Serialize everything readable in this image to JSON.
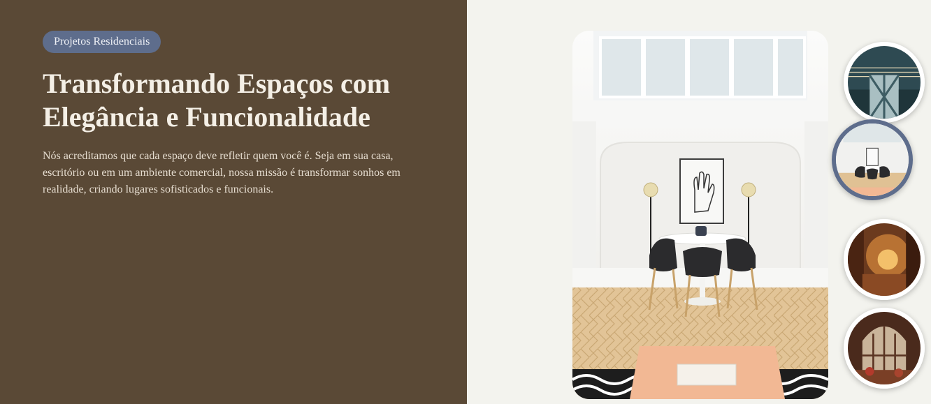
{
  "hero": {
    "badge": "Projetos Residenciais",
    "title": "Transformando Espaços com Elegância e Funcionalidade",
    "description": "Nós acreditamos que cada espaço deve refletir quem você é. Seja em sua casa, escritório ou em um ambiente comercial, nossa missão é transformar sonhos em realidade, criando lugares sofisticados e funcionais."
  },
  "gallery": {
    "active_index": 1,
    "thumbnails": [
      "modern-office-ceiling",
      "white-dining-room",
      "warm-lit-lounge",
      "library-hall"
    ]
  },
  "colors": {
    "left_panel": "#5a4936",
    "right_panel": "#f3f3ee",
    "badge_bg": "#5e6d8c",
    "active_ring": "#5e6d8c"
  }
}
